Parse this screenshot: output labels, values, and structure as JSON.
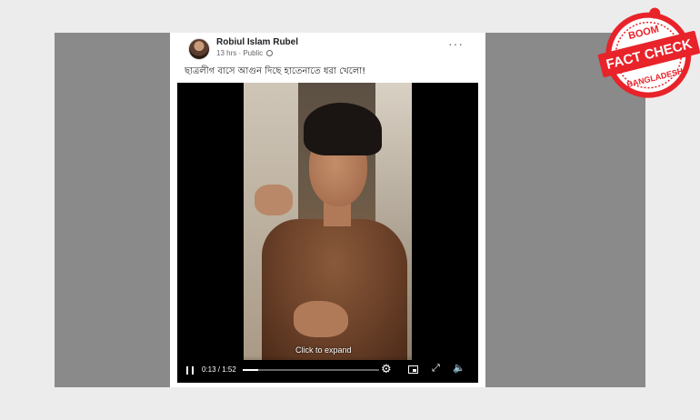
{
  "post": {
    "author": "Robiul Islam Rubel",
    "meta": "13 hrs · Public",
    "more_label": "···",
    "caption": "ছাত্রলীগ বাসে আগুন দিছে হাতেনাতে ধরা খেলো!"
  },
  "video": {
    "overlay": "Click to expand",
    "time": "0:13 / 1:52",
    "progress": 0.116,
    "gear_glyph": "⚙",
    "expand_glyph": "⤢",
    "volume_glyph": "🔈"
  },
  "badge": {
    "top": "BOOM",
    "middle": "FACT CHECK",
    "bottom": "BANGLADESH",
    "color": "#e8232a"
  },
  "icons": {
    "avatar": "avatar",
    "more": "more-icon",
    "globe": "globe-icon",
    "pause": "pause-icon",
    "gear": "gear-icon",
    "pip": "pip-icon",
    "expand": "expand-icon",
    "volume": "volume-icon"
  }
}
